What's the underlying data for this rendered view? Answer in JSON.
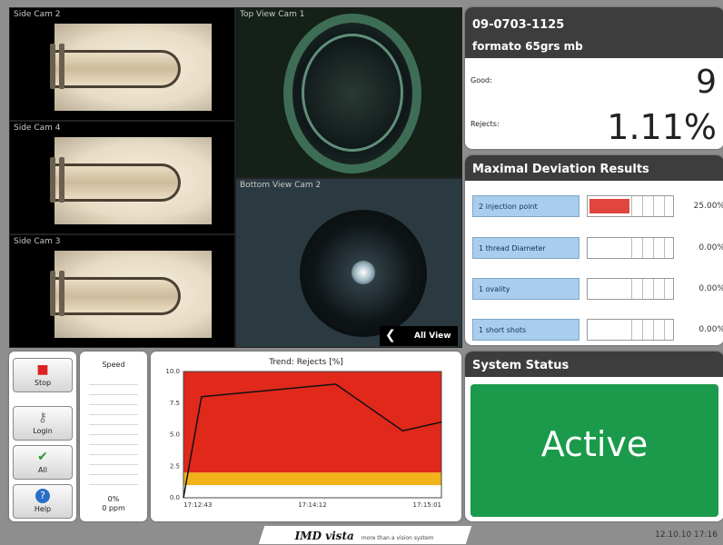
{
  "cameras": {
    "side2_label": "Side Cam 2",
    "side4_label": "Side Cam 4",
    "side3_label": "Side Cam 3",
    "top_label": "Top View Cam 1",
    "bottom_label": "Bottom View Cam 2",
    "all_view_label": "All View"
  },
  "job": {
    "code": "09-0703-1125",
    "format": "formato 65grs mb",
    "good_label": "Good:",
    "good_value": "9",
    "rejects_label": "Rejects:",
    "rejects_value": "1.11%"
  },
  "deviation": {
    "title": "Maximal Deviation Results",
    "rows": [
      {
        "label": "2 injection point",
        "value": "25.00%",
        "fill": 0.25
      },
      {
        "label": "1 thread Diameter",
        "value": "0.00%",
        "fill": 0
      },
      {
        "label": "1 ovality",
        "value": "0.00%",
        "fill": 0
      },
      {
        "label": "1 short shots",
        "value": "0.00%",
        "fill": 0
      }
    ]
  },
  "buttons": {
    "stop": "Stop",
    "login": "Login",
    "all": "All",
    "help": "Help"
  },
  "speed": {
    "title": "Speed",
    "percent": "0%",
    "ppm": "0 ppm"
  },
  "chart_data": {
    "type": "area",
    "title": "Trend: Rejects [%]",
    "y_ticks": [
      "10.0",
      "7.5",
      "5.0",
      "2.5",
      "0.0"
    ],
    "ylim": [
      0,
      10
    ],
    "x_ticks": [
      "17:12:43",
      "17:14:12",
      "17:15:01"
    ],
    "zones": [
      {
        "from": 0,
        "to": 1,
        "color": "#ffffff"
      },
      {
        "from": 1,
        "to": 2,
        "color": "#f2b21b"
      },
      {
        "from": 2,
        "to": 10,
        "color": "#e0281b"
      }
    ],
    "series": [
      {
        "x": [
          0,
          0.07,
          0.59,
          0.85,
          1.0
        ],
        "values": [
          0,
          8.0,
          9.0,
          5.3,
          6.0
        ]
      }
    ]
  },
  "status": {
    "title": "System Status",
    "value": "Active",
    "color": "#1a9a4a"
  },
  "footer": {
    "brand": "IMD vista",
    "tagline": "more than a vision system",
    "datetime": "12.10.10 17:16"
  }
}
